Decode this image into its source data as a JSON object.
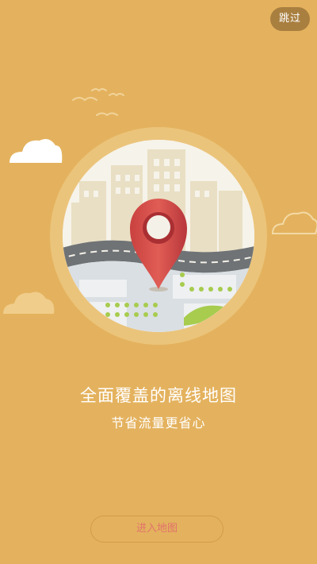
{
  "header": {
    "skip_label": "跳过"
  },
  "intro": {
    "headline": "全面覆盖的离线地图",
    "subline": "节省流量更省心"
  },
  "actions": {
    "enter_label": "进入地图"
  },
  "illustration": {
    "icons": [
      "bird-icon",
      "cloud-icon",
      "city-map-icon",
      "location-pin-icon"
    ]
  },
  "colors": {
    "background": "#e4b25e",
    "pin": "#d9534f",
    "skip_button_bg": "#8b6330",
    "enter_text": "#e1726b"
  }
}
